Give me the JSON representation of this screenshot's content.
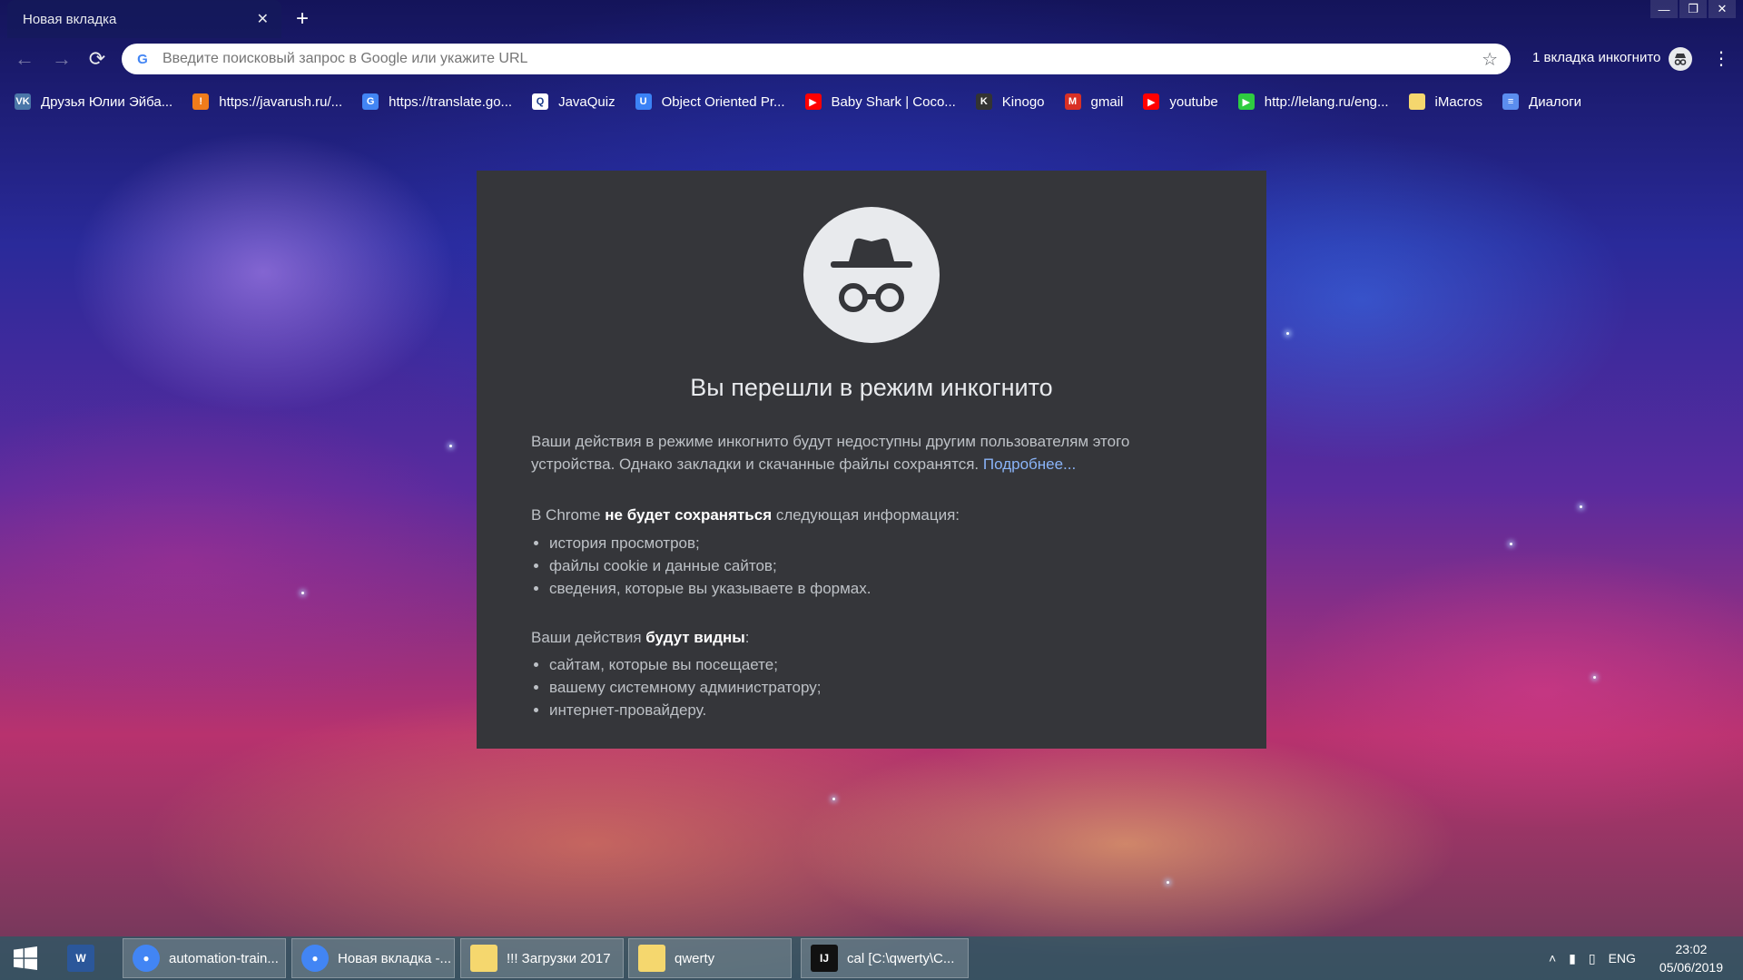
{
  "tab": {
    "title": "Новая вкладка",
    "close_glyph": "✕"
  },
  "new_tab_glyph": "+",
  "window_controls": [
    "—",
    "❐",
    "✕"
  ],
  "toolbar": {
    "back_glyph": "←",
    "forward_glyph": "→",
    "reload_glyph": "⟳",
    "omnibox_placeholder": "Введите поисковый запрос в Google или укажите URL",
    "star_glyph": "☆",
    "incognito_label": "1 вкладка инкогнито",
    "menu_glyph": "⋮"
  },
  "bookmarks": [
    {
      "label": "Друзья Юлии Эйба...",
      "icon": "vk-icon",
      "color": "#4a76a8",
      "glyph": "VK"
    },
    {
      "label": "https://javarush.ru/...",
      "icon": "javarush-icon",
      "color": "#f07c1b",
      "glyph": "!"
    },
    {
      "label": "https://translate.go...",
      "icon": "google-translate-icon",
      "color": "#4285f4",
      "glyph": "G"
    },
    {
      "label": "JavaQuiz",
      "icon": "javaquiz-icon",
      "color": "#ffffff",
      "glyph": "Q"
    },
    {
      "label": "Object Oriented Pr...",
      "icon": "udemy-icon",
      "color": "#3b82f6",
      "glyph": "U"
    },
    {
      "label": "Baby Shark | Coco...",
      "icon": "youtube-icon",
      "color": "#ff0000",
      "glyph": "▶"
    },
    {
      "label": "Kinogo",
      "icon": "kinogo-icon",
      "color": "#333333",
      "glyph": "K"
    },
    {
      "label": "gmail",
      "icon": "gmail-icon",
      "color": "#d93025",
      "glyph": "M"
    },
    {
      "label": "youtube",
      "icon": "youtube-icon",
      "color": "#ff0000",
      "glyph": "▶"
    },
    {
      "label": "http://lelang.ru/eng...",
      "icon": "lelang-icon",
      "color": "#2ecc40",
      "glyph": "▶"
    },
    {
      "label": "iMacros",
      "icon": "folder-icon",
      "color": "#f5d76e",
      "glyph": ""
    },
    {
      "label": "Диалоги",
      "icon": "dialogs-icon",
      "color": "#5b8def",
      "glyph": "≡"
    }
  ],
  "incognito": {
    "title": "Вы перешли в режим инкогнито",
    "p1_text": "Ваши действия в режиме инкогнито будут недоступны другим пользователям этого устройства. Однако закладки и скачанные файлы сохранятся.",
    "learn_more": "Подробнее...",
    "p2_prefix": "В Chrome",
    "p2_bold": "не будет сохраняться",
    "p2_suffix": "следующая информация:",
    "list1": [
      "история просмотров;",
      "файлы cookie и данные сайтов;",
      "сведения, которые вы указываете в формах."
    ],
    "p3_prefix": "Ваши действия",
    "p3_bold": "будут видны",
    "p3_suffix": ":",
    "list2": [
      "сайтам, которые вы посещаете;",
      "вашему системному администратору;",
      "интернет-провайдеру."
    ]
  },
  "taskbar": {
    "apps": [
      {
        "label": "",
        "icon": "word-icon",
        "color": "#2b579a",
        "glyph": "W"
      },
      {
        "label": "automation-train...",
        "icon": "chrome-icon",
        "color": "#4285f4",
        "glyph": "●"
      },
      {
        "label": "Новая вкладка -...",
        "icon": "chrome-icon",
        "color": "#4285f4",
        "glyph": "●"
      },
      {
        "label": "!!! Загрузки 2017",
        "icon": "folder-icon",
        "color": "#f5d76e",
        "glyph": ""
      },
      {
        "label": "qwerty",
        "icon": "folder-icon",
        "color": "#f5d76e",
        "glyph": ""
      },
      {
        "label": "cal [C:\\qwerty\\C...",
        "icon": "intellij-icon",
        "color": "#111111",
        "glyph": "IJ"
      }
    ],
    "tray_up": "˄",
    "tray_signal": "▮",
    "tray_battery": "▯",
    "lang": "ENG",
    "time": "23:02",
    "date": "05/06/2019"
  }
}
